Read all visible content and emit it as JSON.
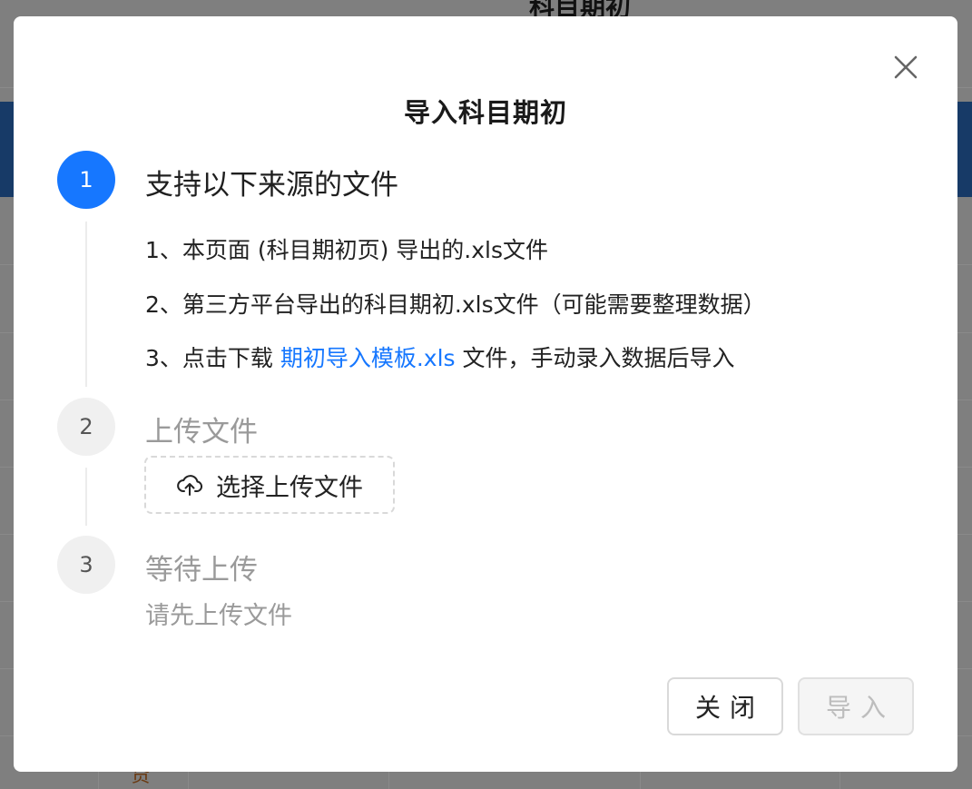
{
  "background": {
    "page_title": "科目期初",
    "cell_char": "贷"
  },
  "modal": {
    "title": "导入科目期初",
    "steps": [
      {
        "number": "1",
        "title": "支持以下来源的文件",
        "items": [
          {
            "text": "1、本页面 (科目期初页) 导出的.xls文件"
          },
          {
            "text": "2、第三方平台导出的科目期初.xls文件（可能需要整理数据）"
          },
          {
            "prefix": "3、点击下载 ",
            "link": "期初导入模板.xls",
            "suffix": " 文件，手动录入数据后导入"
          }
        ]
      },
      {
        "number": "2",
        "title": "上传文件",
        "upload_button": "选择上传文件"
      },
      {
        "number": "3",
        "title": "等待上传",
        "hint": "请先上传文件"
      }
    ],
    "footer": {
      "close_label": "关闭",
      "import_label": "导入"
    }
  },
  "colors": {
    "accent": "#1677ff",
    "overlay": "#7f7f7f"
  }
}
